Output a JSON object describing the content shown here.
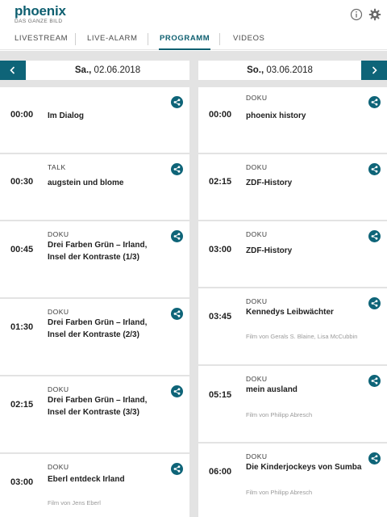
{
  "app": {
    "logo_text": "phoenix",
    "logo_tagline": "DAS GANZE BILD"
  },
  "header": {
    "info_icon": "info-icon",
    "settings_icon": "gear-icon"
  },
  "tabs": [
    {
      "label": "LIVESTREAM",
      "active": false
    },
    {
      "label": "LIVE-ALARM",
      "active": false
    },
    {
      "label": "PROGRAMM",
      "active": true
    },
    {
      "label": "VIDEOS",
      "active": false
    }
  ],
  "colors": {
    "brand": "#0e5f70",
    "nav_button": "#0e6478",
    "background": "#e3e3e3"
  },
  "days": [
    {
      "day": "Sa.,",
      "date": "02.06.2018",
      "nav_icon": "chevron-left-icon",
      "programs": [
        {
          "time": "00:00",
          "genre": "",
          "title": "Im Dialog",
          "credit": ""
        },
        {
          "time": "00:30",
          "genre": "TALK",
          "title": "augstein und blome",
          "credit": ""
        },
        {
          "time": "00:45",
          "genre": "DOKU",
          "title": "Drei Farben Grün – Irland, Insel der Kontraste (1/3)",
          "credit": ""
        },
        {
          "time": "01:30",
          "genre": "DOKU",
          "title": "Drei Farben Grün – Irland, Insel der Kontraste (2/3)",
          "credit": ""
        },
        {
          "time": "02:15",
          "genre": "DOKU",
          "title": "Drei Farben Grün – Irland, Insel der Kontraste (3/3)",
          "credit": ""
        },
        {
          "time": "03:00",
          "genre": "DOKU",
          "title": "Eberl entdeck Irland",
          "credit": "Film von Jens Eberl"
        }
      ]
    },
    {
      "day": "So.,",
      "date": "03.06.2018",
      "nav_icon": "chevron-right-icon",
      "programs": [
        {
          "time": "00:00",
          "genre": "DOKU",
          "title": "phoenix history",
          "credit": ""
        },
        {
          "time": "02:15",
          "genre": "DOKU",
          "title": "ZDF-History",
          "credit": ""
        },
        {
          "time": "03:00",
          "genre": "DOKU",
          "title": "ZDF-History",
          "credit": ""
        },
        {
          "time": "03:45",
          "genre": "DOKU",
          "title": "Kennedys Leibwächter",
          "credit": "Film von Gerals S. Blaine, Lisa McCubbin"
        },
        {
          "time": "05:15",
          "genre": "DOKU",
          "title": "mein ausland",
          "credit": "Film von Philipp Abresch"
        },
        {
          "time": "06:00",
          "genre": "DOKU",
          "title": "Die Kinderjockeys von Sumba",
          "credit": "Film von Philipp Abresch"
        }
      ]
    }
  ]
}
